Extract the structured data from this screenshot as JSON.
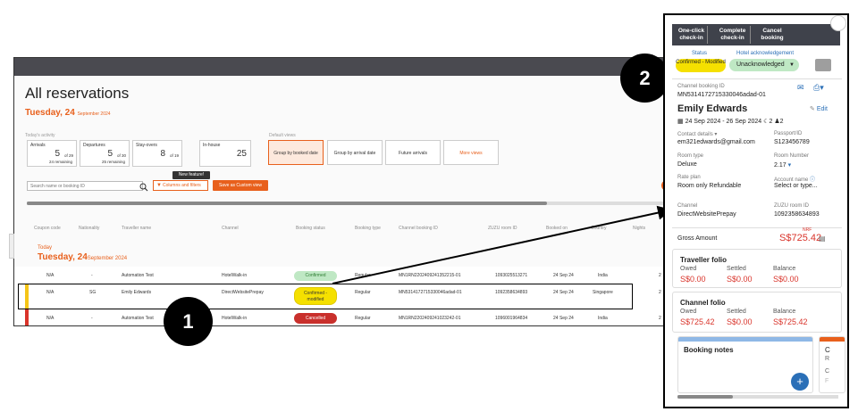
{
  "main": {
    "title": "All reservations",
    "date_prefix": "Tuesday, 24",
    "date_suffix": "September 2024",
    "todays_activity": "Today's activity",
    "default_views": "Default views",
    "stats": [
      {
        "label": "Arrivals",
        "value": "5",
        "of": "of 29",
        "remaining": "24 remaining"
      },
      {
        "label": "Departures",
        "value": "5",
        "of": "of 30",
        "remaining": "25 remaining"
      },
      {
        "label": "Stay-overs",
        "value": "8",
        "of": "of 19",
        "remaining": ""
      },
      {
        "label": "In-house",
        "value": "25",
        "of": "",
        "remaining": ""
      }
    ],
    "views": [
      "Group by booked date",
      "Group by arrival date",
      "Future arrivals",
      "More views"
    ],
    "search_placeholder": "Search name or booking ID",
    "columns_filters": "Columns and filters",
    "new_feature": "New feature!",
    "save_custom": "Save as Custom view",
    "columns": [
      "Coupon code",
      "Nationality",
      "Traveller name",
      "Channel",
      "Booking status",
      "Booking type",
      "Channel booking ID",
      "ZUZU room ID",
      "Booked on",
      "Country",
      "Nights"
    ],
    "group_today": "Today",
    "group_date_prefix": "Tuesday, 24",
    "group_date_suffix": "September 2024",
    "rows": [
      {
        "coupon": "N/A",
        "nationality": "-",
        "traveller": "Automation Test",
        "channel": "HotelWalk-in",
        "status": "Confirmed",
        "type": "Regular",
        "channel_id": "MN1RN2202409241352215-01",
        "room_id": "1093025513271",
        "booked": "24 Sep 24",
        "country": "India",
        "nights": "2",
        "bar_color": "#ffffff"
      },
      {
        "coupon": "N/A",
        "nationality": "SG",
        "traveller": "Emily Edwards",
        "channel": "DirectWebsitePrepay",
        "status": "Confirmed - modified",
        "type": "Regular",
        "channel_id": "MN5314172715330046adad-01",
        "room_id": "1092358634893",
        "booked": "24 Sep 24",
        "country": "Singapore",
        "nights": "2",
        "bar_color": "#f5c518"
      },
      {
        "coupon": "N/A",
        "nationality": "-",
        "traveller": "Automation Test",
        "channel": "HotelWalk-in",
        "status": "Cancelled",
        "type": "Regular",
        "channel_id": "MN1RN2202409241023242-01",
        "room_id": "1096001964834",
        "booked": "24 Sep 24",
        "country": "India",
        "nights": "2",
        "bar_color": "#d9342b"
      }
    ]
  },
  "markers": {
    "one": "1",
    "two": "2"
  },
  "panel": {
    "buttons": [
      "One-click check-in",
      "Complete check-in",
      "Cancel booking"
    ],
    "status_label": "Status",
    "status_value": "Confirmed - Modified",
    "ack_label": "Hotel acknowledgement",
    "ack_value": "Unacknowledged",
    "channel_booking_label": "Channel booking ID",
    "channel_booking_id": "MN5314172715330046adad-01",
    "guest_name": "Emily Edwards",
    "edit": "Edit",
    "dates": "24 Sep 2024 - 26 Sep 2024",
    "nights": "2",
    "guests": "2",
    "contact_label": "Contact details",
    "contact_email": "em321edwards@gmail.com",
    "passport_label": "Passport/ID",
    "passport_value": "S123456789",
    "room_type_label": "Room type",
    "room_type_value": "Deluxe",
    "room_number_label": "Room Number",
    "room_number_value": "2.17",
    "rate_plan_label": "Rate plan",
    "rate_plan_value": "Room only Refundable",
    "account_name_label": "Account name",
    "account_name_value": "Select or type...",
    "channel_label": "Channel",
    "channel_value": "DirectWebsitePrepay",
    "zuzu_label": "ZUZU room ID",
    "zuzu_value": "1092358634893",
    "gross_label": "Gross Amount",
    "nrf": "NRF",
    "gross_value": "S$725.42",
    "traveller_folio": {
      "title": "Traveller folio",
      "owed_label": "Owed",
      "settled_label": "Settled",
      "balance_label": "Balance",
      "owed": "S$0.00",
      "settled": "S$0.00",
      "balance": "S$0.00"
    },
    "channel_folio": {
      "title": "Channel folio",
      "owed_label": "Owed",
      "settled_label": "Settled",
      "balance_label": "Balance",
      "owed": "S$725.42",
      "settled": "S$0.00",
      "balance": "S$725.42"
    },
    "booking_notes": "Booking notes",
    "side_card_letters": [
      "C",
      "R",
      "C",
      "F"
    ]
  },
  "colors": {
    "accent": "#e8601c",
    "confirmed_bg": "#bfe8c4",
    "modified_bg": "#f5e000",
    "cancelled_bg": "#c9302c",
    "ack_bg": "#bfe8c4",
    "blue": "#2a6fb7"
  }
}
